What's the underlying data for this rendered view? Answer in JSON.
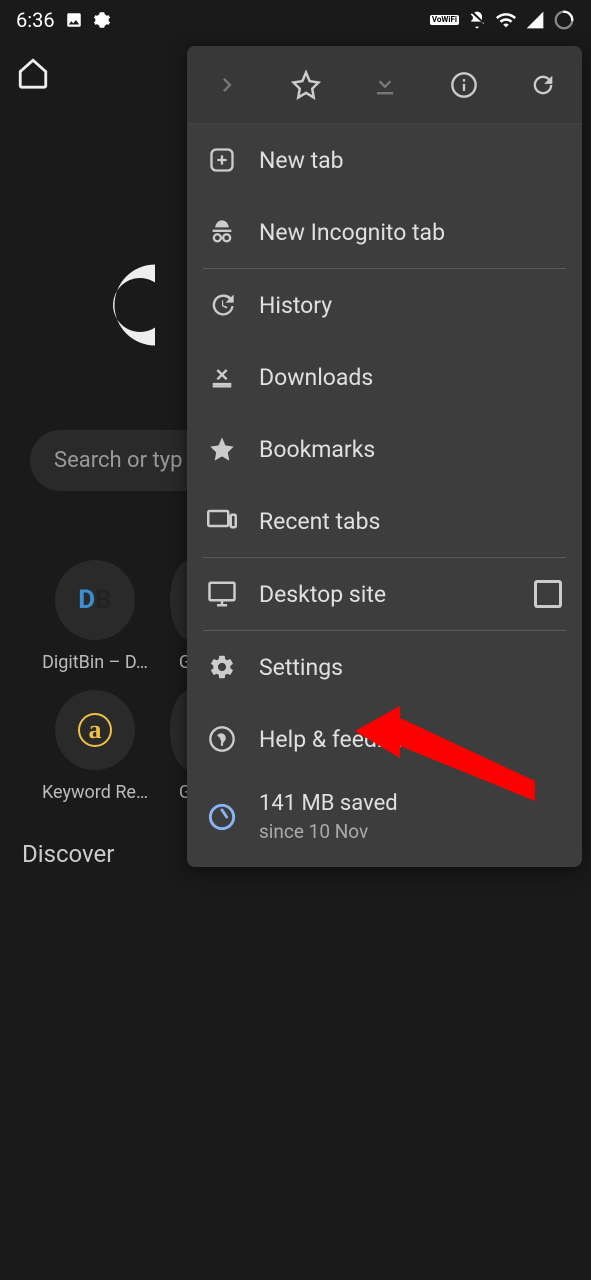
{
  "status_bar": {
    "time": "6:36",
    "vowifi_label": "VoWiFi"
  },
  "search": {
    "placeholder": "Search or typ"
  },
  "shortcuts": [
    {
      "label": "DigitBin – D…",
      "badge_d": "D",
      "badge_b": "B"
    },
    {
      "label": "G"
    },
    {
      "label": "Keyword Re…",
      "badge": "a"
    },
    {
      "label": "G"
    }
  ],
  "discover_label": "Discover",
  "menu": {
    "new_tab": "New tab",
    "incognito": "New Incognito tab",
    "history": "History",
    "downloads": "Downloads",
    "bookmarks": "Bookmarks",
    "recent_tabs": "Recent tabs",
    "desktop_site": "Desktop site",
    "settings": "Settings",
    "help": "Help & feedback",
    "saved_main": "141 MB saved",
    "saved_sub": "since 10 Nov"
  }
}
